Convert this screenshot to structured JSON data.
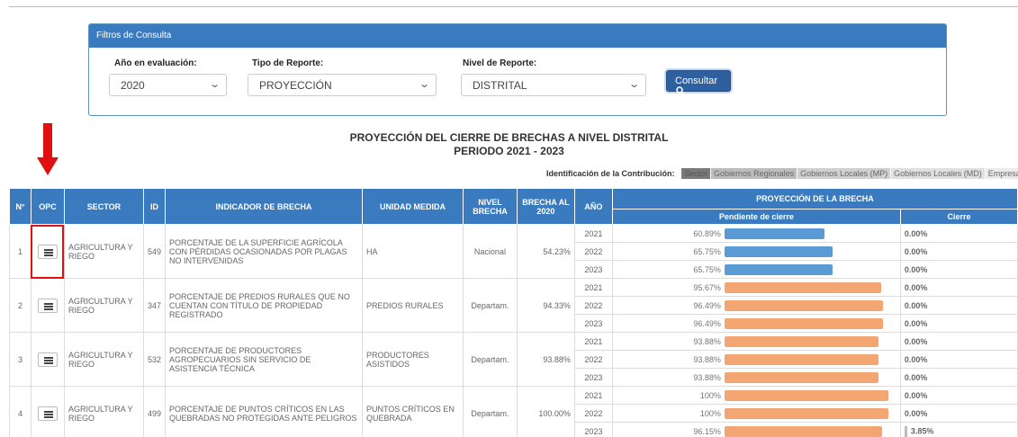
{
  "filters": {
    "header": "Filtros de Consulta",
    "anio_label": "Año en evaluación:",
    "anio_value": "2020",
    "tipo_label": "Tipo de Reporte:",
    "tipo_value": "PROYECCIÓN",
    "nivel_label": "Nivel de Reporte:",
    "nivel_value": "DISTRITAL",
    "consultar_label": "Consultar",
    "chevron_icon": "chevron-down-icon",
    "search_icon": "search-icon"
  },
  "report": {
    "title": "PROYECCIÓN DEL CIERRE DE BRECHAS A NIVEL DISTRITAL",
    "subtitle": "PERIODO 2021 - 2023"
  },
  "legend": {
    "label": "Identificación de la Contribución:",
    "items": [
      {
        "label": "Sector",
        "color": "#7a7a7a"
      },
      {
        "label": "Gobiernos Regionales",
        "color": "#bdbdbd"
      },
      {
        "label": "Gobiernos Locales (MP)",
        "color": "#d0d0d0"
      },
      {
        "label": "Gobiernos Locales (MD)",
        "color": "#e0e0e0"
      },
      {
        "label": "Empresas",
        "color": "#ebebeb"
      }
    ]
  },
  "table": {
    "headers": {
      "n": "N°",
      "opc": "OPC",
      "sector": "SECTOR",
      "id": "ID",
      "indicador": "INDICADOR DE BRECHA",
      "unidad": "UNIDAD MEDIDA",
      "nivel": "NIVEL BRECHA",
      "brecha": "BRECHA AL 2020",
      "anio": "AÑO",
      "proyeccion": "PROYECCIÓN DE LA BRECHA",
      "pendiente": "Pendiente de cierre",
      "cierre": "Cierre"
    },
    "colors": {
      "blue_bar": "#5b9bd5",
      "orange_bar": "#f4a672"
    },
    "rows": [
      {
        "n": "1",
        "sector": "AGRICULTURA Y RIEGO",
        "id": "549",
        "indicador": "PORCENTAJE DE LA SUPERFICIE AGRÍCOLA CON PÉRDIDAS OCASIONADAS POR PLAGAS NO INTERVENIDAS",
        "unidad": "HA",
        "nivel": "Nacional",
        "brecha": "54.23%",
        "bar_color": "blue",
        "years": [
          {
            "anio": "2021",
            "pendiente": "60.89%",
            "fill": 0.6089,
            "cierre": "0.00%"
          },
          {
            "anio": "2022",
            "pendiente": "65.75%",
            "fill": 0.6575,
            "cierre": "0.00%"
          },
          {
            "anio": "2023",
            "pendiente": "65.75%",
            "fill": 0.6575,
            "cierre": "0.00%"
          }
        ]
      },
      {
        "n": "2",
        "sector": "AGRICULTURA Y RIEGO",
        "id": "347",
        "indicador": "PORCENTAJE DE PREDIOS RURALES QUE NO CUENTAN CON TÍTULO DE PROPIEDAD REGISTRADO",
        "unidad": "PREDIOS RURALES",
        "nivel": "Departam.",
        "brecha": "94.33%",
        "bar_color": "orange",
        "years": [
          {
            "anio": "2021",
            "pendiente": "95.67%",
            "fill": 0.9567,
            "cierre": "0.00%"
          },
          {
            "anio": "2022",
            "pendiente": "96.49%",
            "fill": 0.9649,
            "cierre": "0.00%"
          },
          {
            "anio": "2023",
            "pendiente": "96.49%",
            "fill": 0.9649,
            "cierre": "0.00%"
          }
        ]
      },
      {
        "n": "3",
        "sector": "AGRICULTURA Y RIEGO",
        "id": "532",
        "indicador": "PORCENTAJE DE PRODUCTORES AGROPECUARIOS SIN SERVICIO DE ASISTENCIA TÉCNICA",
        "unidad": "PRODUCTORES ASISTIDOS",
        "nivel": "Departam.",
        "brecha": "93.88%",
        "bar_color": "orange",
        "years": [
          {
            "anio": "2021",
            "pendiente": "93.88%",
            "fill": 0.9388,
            "cierre": "0.00%"
          },
          {
            "anio": "2022",
            "pendiente": "93.88%",
            "fill": 0.9388,
            "cierre": "0.00%"
          },
          {
            "anio": "2023",
            "pendiente": "93.88%",
            "fill": 0.9388,
            "cierre": "0.00%"
          }
        ]
      },
      {
        "n": "4",
        "sector": "AGRICULTURA Y RIEGO",
        "id": "499",
        "indicador": "PORCENTAJE DE PUNTOS CRÍTICOS EN LAS QUEBRADAS NO PROTEGIDAS ANTE PELIGROS",
        "unidad": "PUNTOS CRÍTICOS EN QUEBRADA",
        "nivel": "Departam.",
        "brecha": "100.00%",
        "bar_color": "orange",
        "years": [
          {
            "anio": "2021",
            "pendiente": "100%",
            "fill": 1.0,
            "cierre": "0.00%"
          },
          {
            "anio": "2022",
            "pendiente": "100%",
            "fill": 1.0,
            "cierre": "0.00%"
          },
          {
            "anio": "2023",
            "pendiente": "96.15%",
            "fill": 0.9615,
            "cierre": "3.85%",
            "cierre_bar": true
          }
        ]
      }
    ]
  },
  "annotation": {
    "arrow_icon": "red-arrow-down-icon",
    "highlight_row": 0
  }
}
